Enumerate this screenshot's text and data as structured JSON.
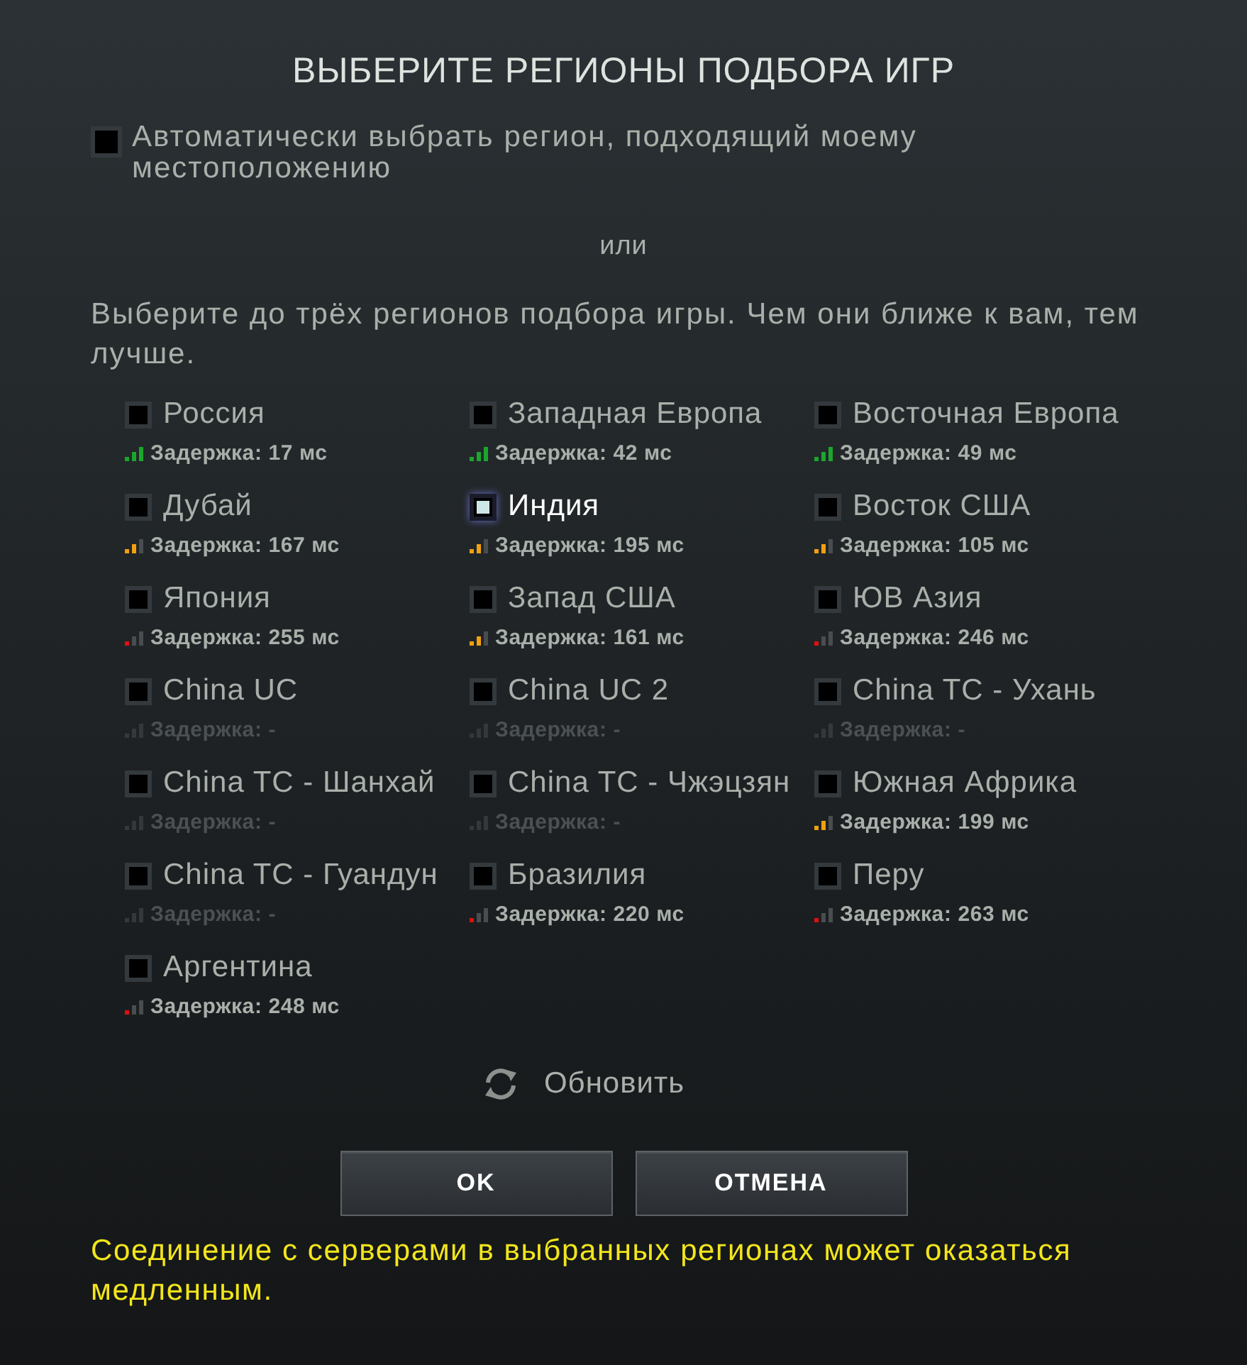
{
  "title": "ВЫБЕРИТЕ РЕГИОНЫ ПОДБОРА ИГР",
  "auto_region": {
    "label": "Автоматически выбрать регион, подходящий моему местоположению",
    "checked": false
  },
  "separator": "или",
  "instructions": "Выберите до трёх регионов подбора игры. Чем они ближе к вам, тем лучше.",
  "regions": [
    {
      "name": "Россия",
      "checked": false,
      "kind": "good",
      "latency": "Задержка: 17 мс"
    },
    {
      "name": "Западная Европа",
      "checked": false,
      "kind": "good",
      "latency": "Задержка: 42 мс"
    },
    {
      "name": "Восточная Европа",
      "checked": false,
      "kind": "good",
      "latency": "Задержка: 49 мс"
    },
    {
      "name": "Дубай",
      "checked": false,
      "kind": "fair",
      "latency": "Задержка: 167 мс"
    },
    {
      "name": "Индия",
      "checked": true,
      "kind": "fair",
      "latency": "Задержка: 195 мс"
    },
    {
      "name": "Восток США",
      "checked": false,
      "kind": "fair",
      "latency": "Задержка: 105 мс"
    },
    {
      "name": "Япония",
      "checked": false,
      "kind": "poor",
      "latency": "Задержка: 255 мс"
    },
    {
      "name": "Запад США",
      "checked": false,
      "kind": "fair",
      "latency": "Задержка: 161 мс"
    },
    {
      "name": "ЮВ Азия",
      "checked": false,
      "kind": "poor",
      "latency": "Задержка: 246 мс"
    },
    {
      "name": "China UC",
      "checked": false,
      "kind": "unknown",
      "latency": "Задержка: -"
    },
    {
      "name": "China UC 2",
      "checked": false,
      "kind": "unknown",
      "latency": "Задержка: -"
    },
    {
      "name": "China TC - Ухань",
      "checked": false,
      "kind": "unknown",
      "latency": "Задержка: -"
    },
    {
      "name": "China TC - Шанхай",
      "checked": false,
      "kind": "unknown",
      "latency": "Задержка: -"
    },
    {
      "name": "China TC - Чжэцзян",
      "checked": false,
      "kind": "unknown",
      "latency": "Задержка: -"
    },
    {
      "name": "Южная Африка",
      "checked": false,
      "kind": "fair",
      "latency": "Задержка: 199 мс"
    },
    {
      "name": "China TC - Гуандун",
      "checked": false,
      "kind": "unknown",
      "latency": "Задержка: -"
    },
    {
      "name": "Бразилия",
      "checked": false,
      "kind": "poor",
      "latency": "Задержка: 220 мс"
    },
    {
      "name": "Перу",
      "checked": false,
      "kind": "poor",
      "latency": "Задержка: 263 мс"
    },
    {
      "name": "Аргентина",
      "checked": false,
      "kind": "poor",
      "latency": "Задержка: 248 мс"
    }
  ],
  "refresh": {
    "label": "Обновить"
  },
  "buttons": [
    "OK",
    "ОТМЕНА"
  ],
  "warning": "Соединение с серверами в выбранных регионах может оказаться медленным."
}
